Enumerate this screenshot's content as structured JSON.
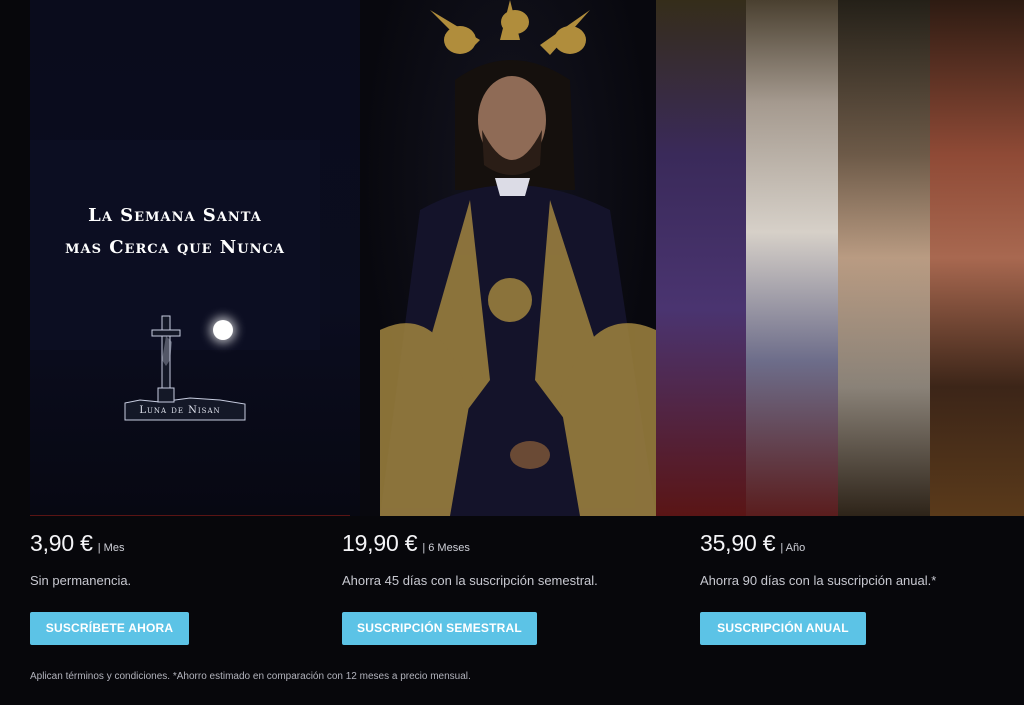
{
  "hero": {
    "tagline_line1": "La Semana Santa",
    "tagline_line2": "mas Cerca que Nunca",
    "logo_text": "Luna de Nisan"
  },
  "plans": [
    {
      "price": "3,90 €",
      "period": "| Mes",
      "description": "Sin permanencia.",
      "button_label": "SUSCRÍBETE AHORA"
    },
    {
      "price": "19,90 €",
      "period": "| 6 Meses",
      "description": "Ahorra 45 días con la suscripción semestral.",
      "button_label": "SUSCRIPCIÓN SEMESTRAL"
    },
    {
      "price": "35,90 €",
      "period": "| Año",
      "description": "Ahorra 90 días con la suscripción anual.*",
      "button_label": "SUSCRIPCIÓN ANUAL"
    }
  ],
  "footnote": "Aplican términos y condiciones. *Ahorro estimado en comparación con 12 meses a precio mensual.",
  "colors": {
    "background": "#07070b",
    "button": "#5cc3e6",
    "text": "#e9e9ee"
  },
  "icons": [
    "cross-logo-icon",
    "moon-icon"
  ]
}
